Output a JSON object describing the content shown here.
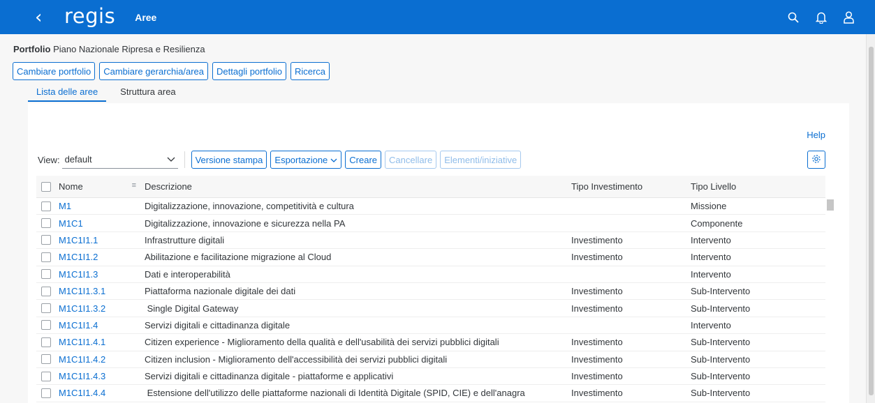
{
  "shell": {
    "back_icon": "chevron-left-icon",
    "logo": "regis",
    "title": "Aree",
    "actions": [
      "search-icon",
      "bell-icon",
      "user-icon"
    ]
  },
  "portfolio": {
    "label": "Portfolio",
    "value": "Piano Nazionale Ripresa e Resilienza"
  },
  "top_buttons": [
    "Cambiare portfolio",
    "Cambiare gerarchia/area",
    "Dettagli portfolio",
    "Ricerca"
  ],
  "tabs": [
    {
      "label": "Lista delle aree",
      "active": true
    },
    {
      "label": "Struttura area",
      "active": false
    }
  ],
  "help": "Help",
  "toolbar": {
    "view_label": "View:",
    "view_value": "default",
    "buttons": [
      {
        "label": "Versione stampa",
        "enabled": true
      },
      {
        "label": "Esportazione",
        "enabled": true,
        "dropdown": true
      },
      {
        "label": "Creare",
        "enabled": true
      },
      {
        "label": "Cancellare",
        "enabled": false
      },
      {
        "label": "Elementi/iniziative",
        "enabled": false
      }
    ],
    "settings_icon": "gear-icon"
  },
  "table": {
    "columns": [
      "Nome",
      "Descrizione",
      "Tipo Investimento",
      "Tipo Livello"
    ],
    "rows": [
      [
        "M1",
        "Digitalizzazione, innovazione, competitività e cultura",
        "",
        "Missione"
      ],
      [
        "M1C1",
        "Digitalizzazione, innovazione e sicurezza nella PA",
        "",
        "Componente"
      ],
      [
        "M1C1I1.1",
        "Infrastrutture digitali",
        "Investimento",
        "Intervento"
      ],
      [
        "M1C1I1.2",
        "Abilitazione e facilitazione migrazione al Cloud",
        "Investimento",
        "Intervento"
      ],
      [
        "M1C1I1.3",
        "Dati e interoperabilità",
        "",
        "Intervento"
      ],
      [
        "M1C1I1.3.1",
        "Piattaforma nazionale digitale dei dati",
        "Investimento",
        "Sub-Intervento"
      ],
      [
        "M1C1I1.3.2",
        " Single Digital Gateway",
        "Investimento",
        "Sub-Intervento"
      ],
      [
        "M1C1I1.4",
        "Servizi digitali e cittadinanza digitale",
        "",
        "Intervento"
      ],
      [
        "M1C1I1.4.1",
        "Citizen experience - Miglioramento della qualità e dell'usabilità dei servizi pubblici digitali",
        "Investimento",
        "Sub-Intervento"
      ],
      [
        "M1C1I1.4.2",
        "Citizen inclusion - Miglioramento dell'accessibilità dei servizi pubblici digitali",
        "Investimento",
        "Sub-Intervento"
      ],
      [
        "M1C1I1.4.3",
        "Servizi digitali e cittadinanza digitale - piattaforme e applicativi",
        "Investimento",
        "Sub-Intervento"
      ],
      [
        "M1C1I1.4.4",
        " Estensione dell'utilizzo delle piattaforme nazionali di Identità Digitale (SPID, CIE) e dell'anagra",
        "Investimento",
        "Sub-Intervento"
      ]
    ]
  }
}
